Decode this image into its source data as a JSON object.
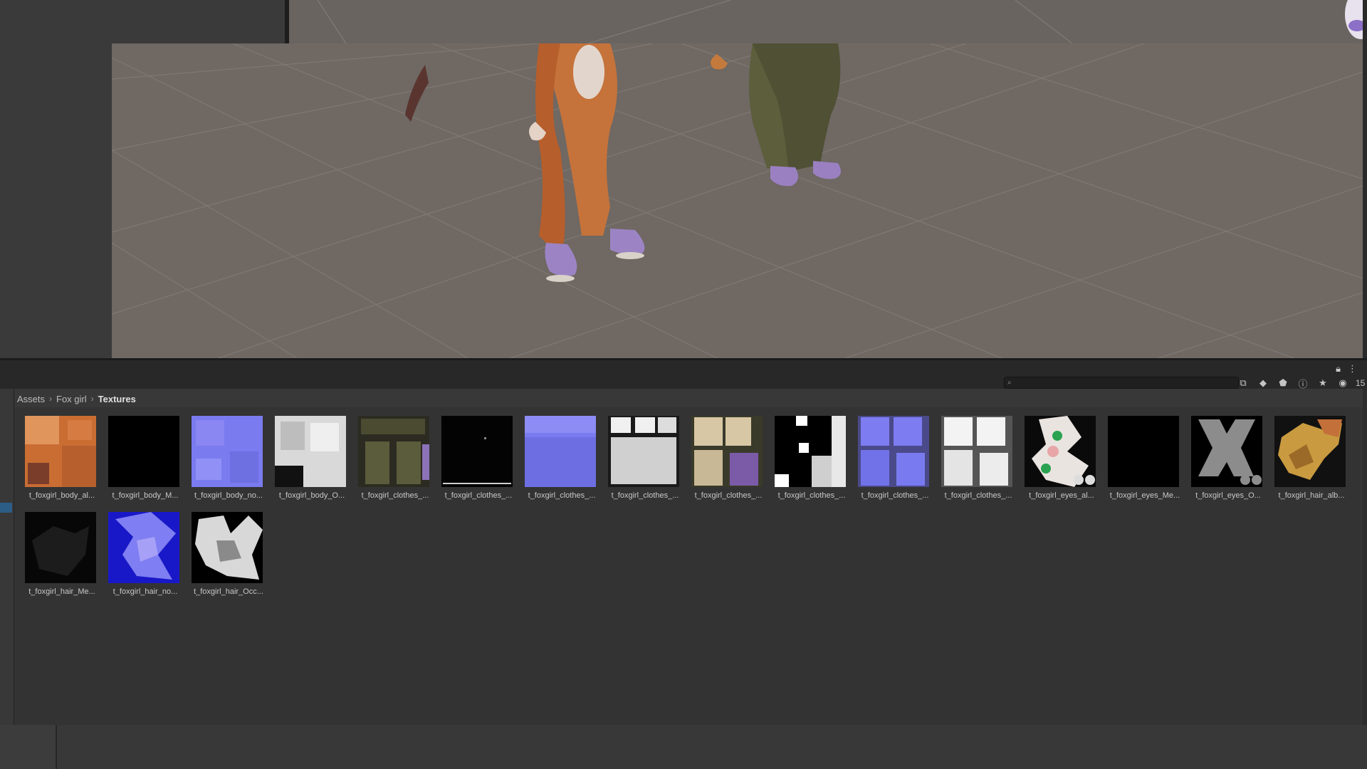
{
  "breadcrumb": {
    "items": [
      "Assets",
      "Fox girl"
    ],
    "current": "Textures"
  },
  "search": {
    "placeholder": ""
  },
  "toolbar": {
    "hidden_count": "15"
  },
  "assets": [
    {
      "label": "t_foxgirl_body_al...",
      "icon": "albedo-texture-thumbnail"
    },
    {
      "label": "t_foxgirl_body_M...",
      "icon": "metallic-texture-thumbnail"
    },
    {
      "label": "t_foxgirl_body_no...",
      "icon": "normal-map-thumbnail"
    },
    {
      "label": "t_foxgirl_body_O...",
      "icon": "occlusion-texture-thumbnail"
    },
    {
      "label": "t_foxgirl_clothes_...",
      "icon": "albedo-texture-thumbnail"
    },
    {
      "label": "t_foxgirl_clothes_...",
      "icon": "metallic-texture-thumbnail"
    },
    {
      "label": "t_foxgirl_clothes_...",
      "icon": "normal-map-thumbnail"
    },
    {
      "label": "t_foxgirl_clothes_...",
      "icon": "occlusion-texture-thumbnail"
    },
    {
      "label": "t_foxgirl_clothes_...",
      "icon": "albedo-texture-thumbnail"
    },
    {
      "label": "t_foxgirl_clothes_...",
      "icon": "mask-texture-thumbnail"
    },
    {
      "label": "t_foxgirl_clothes_...",
      "icon": "normal-map-thumbnail"
    },
    {
      "label": "t_foxgirl_clothes_...",
      "icon": "occlusion-texture-thumbnail"
    },
    {
      "label": "t_foxgirl_eyes_al...",
      "icon": "albedo-texture-thumbnail"
    },
    {
      "label": "t_foxgirl_eyes_Me...",
      "icon": "metallic-texture-thumbnail"
    },
    {
      "label": "t_foxgirl_eyes_O...",
      "icon": "occlusion-texture-thumbnail"
    },
    {
      "label": "t_foxgirl_hair_alb...",
      "icon": "albedo-texture-thumbnail"
    },
    {
      "label": "t_foxgirl_hair_Me...",
      "icon": "metallic-texture-thumbnail"
    },
    {
      "label": "t_foxgirl_hair_no...",
      "icon": "normal-map-thumbnail"
    },
    {
      "label": "t_foxgirl_hair_Occ...",
      "icon": "occlusion-texture-thumbnail"
    }
  ],
  "colors": {
    "selection": "#2c5d87",
    "normal_map": "#7b7bf0",
    "panel_bg": "#333333",
    "scene_floor": "#6f6863"
  }
}
